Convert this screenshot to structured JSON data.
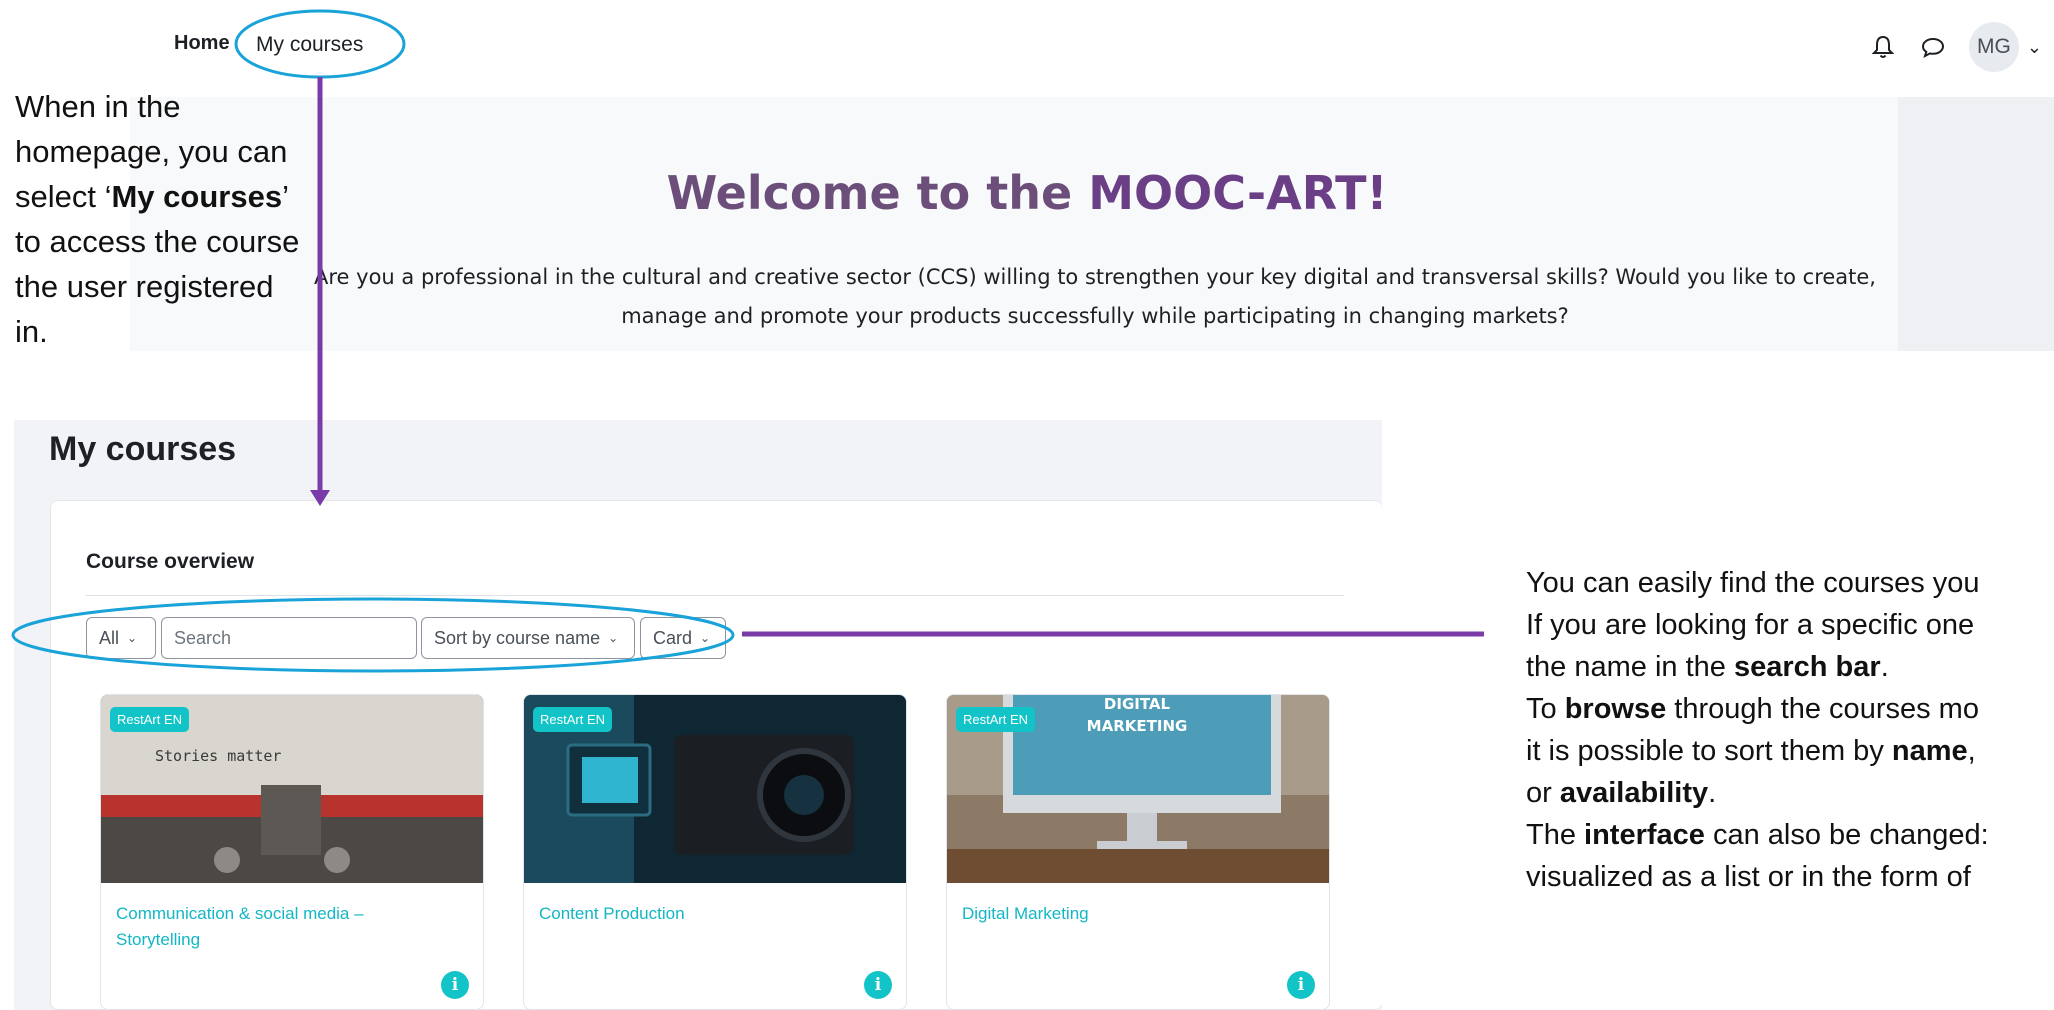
{
  "navbar": {
    "home_label": "Home",
    "mycourses_label": "My courses",
    "notification_icon": "bell-icon",
    "messages_icon": "chat-bubble-icon",
    "user_initials": "MG",
    "user_menu_icon": "chevron-down-icon"
  },
  "welcome": {
    "title_prefix": "Welcome to the ",
    "title_brand": "MOOC-ART!",
    "text": "Are you a professional in the cultural and creative sector (CCS) willing to strengthen your key digital and transversal skills? Would you like to create, manage and promote your products successfully while participating in changing markets?"
  },
  "annotation_left": {
    "line1": "When in the homepage, you can select ‘",
    "bold1": "My courses",
    "line2": "’ to access the course the user registered in."
  },
  "section": {
    "title": "My courses",
    "overview_label": "Course overview"
  },
  "filters": {
    "grouping": "All",
    "search_placeholder": "Search",
    "sort": "Sort by course name",
    "view": "Card"
  },
  "courses": [
    {
      "badge": "RestArt EN",
      "name": "Communication & social media – Storytelling",
      "image_text": "Stories matter"
    },
    {
      "badge": "RestArt EN",
      "name": "Content Production"
    },
    {
      "badge": "RestArt EN",
      "name": "Digital Marketing",
      "image_text_1": "DIGITAL",
      "image_text_2": "MARKETING"
    }
  ],
  "annotation_right": {
    "p1": "You can easily find the courses you",
    "p2a": "If you are looking for a specific one",
    "p3a": "the name in the ",
    "p3b": "search bar",
    "p3c": ".",
    "p4a": "To ",
    "p4b": "browse",
    "p4c": " through the courses mo",
    "p5a": "it is possible to sort them by ",
    "p5b": "name",
    "p5c": ",",
    "p6a": "or ",
    "p6b": "availability",
    "p6c": ".",
    "p7a": "The ",
    "p7b": "interface",
    "p7c": " can also be changed:",
    "p8": "visualized as a list or in the form of"
  },
  "colors": {
    "annotation_blue": "#1aa3d9",
    "annotation_purple": "#7a3aa8",
    "accent_teal": "#12c4c7",
    "title_purple": "#6b3f86"
  }
}
